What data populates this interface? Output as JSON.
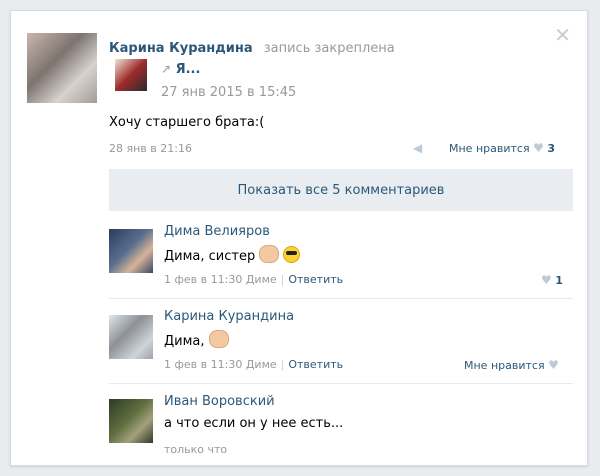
{
  "post": {
    "author": "Карина Курандина",
    "action": "запись закреплена",
    "repost_title": "Я...",
    "repost_date": "27 янв 2015 в 15:45",
    "text": "Хочу старшего брата:(",
    "date": "28 янв в 21:16",
    "like_label": "Мне нравится",
    "like_count": "3",
    "close_icon": "close-icon"
  },
  "show_all_comments": "Показать все 5 комментариев",
  "comments": [
    {
      "author": "Дима Велияров",
      "text": "Дима, систер",
      "date": "1 фев в 11:30",
      "reply_to": "Диме",
      "reply_label": "Ответить",
      "like_count": "1"
    },
    {
      "author": "Карина Курандина",
      "text": "Дима,",
      "date": "1 фев в 11:30",
      "reply_to": "Диме",
      "reply_label": "Ответить",
      "like_label": "Мне нравится"
    },
    {
      "author": "Иван Воровский",
      "text": "а что если он у нее есть...",
      "date": "только что"
    }
  ]
}
